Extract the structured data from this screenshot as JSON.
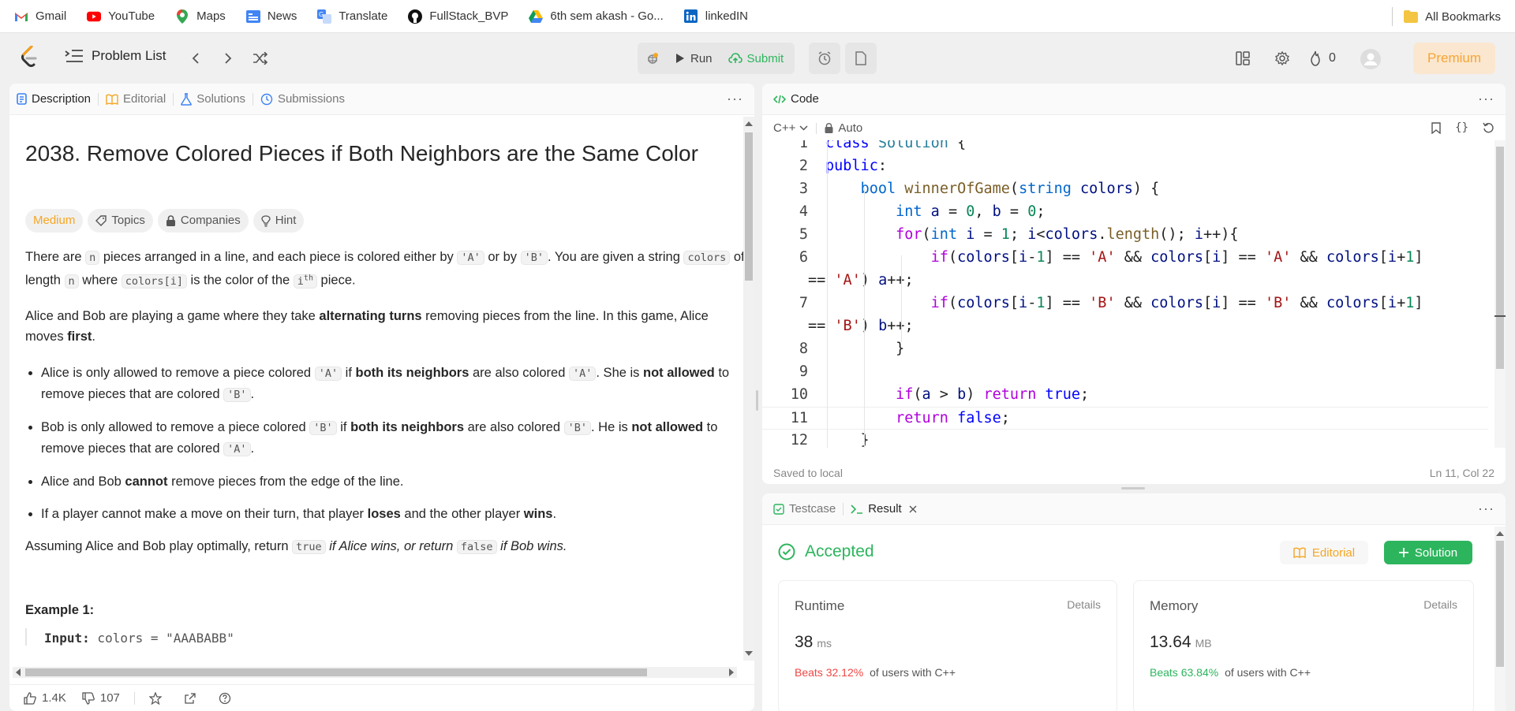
{
  "bookmarks": [
    {
      "label": "Gmail",
      "icon": "gmail-icon"
    },
    {
      "label": "YouTube",
      "icon": "youtube-icon"
    },
    {
      "label": "Maps",
      "icon": "maps-icon"
    },
    {
      "label": "News",
      "icon": "news-icon"
    },
    {
      "label": "Translate",
      "icon": "translate-icon"
    },
    {
      "label": "FullStack_BVP",
      "icon": "github-icon"
    },
    {
      "label": "6th sem akash - Go...",
      "icon": "drive-icon"
    },
    {
      "label": "linkedIN",
      "icon": "linkedin-icon"
    }
  ],
  "all_bookmarks": "All Bookmarks",
  "nav": {
    "problem_list": "Problem List",
    "run": "Run",
    "submit": "Submit",
    "streak": "0",
    "premium": "Premium"
  },
  "desc_tabs": [
    "Description",
    "Editorial",
    "Solutions",
    "Submissions"
  ],
  "problem": {
    "title": "2038. Remove Colored Pieces if Both Neighbors are the Same Color",
    "difficulty": "Medium",
    "topics": "Topics",
    "companies": "Companies",
    "hint": "Hint",
    "p1": {
      "a": "There are ",
      "n": "n",
      "b": " pieces arranged in a line, and each piece is colored either by ",
      "A": "'A'",
      "c": " or by ",
      "B": "'B'",
      "d": ". You are given a string ",
      "colors": "colors",
      "e": " of length ",
      "n2": "n",
      "f": " where ",
      "ci": "colors[i]",
      "g": " is the color of the ",
      "i": "i",
      "th": "th",
      "h": " piece."
    },
    "p2": {
      "a": "Alice and Bob are playing a game where they take ",
      "b": "alternating turns",
      "c": " removing pieces from the line. In this game, Alice moves ",
      "d": "first",
      "e": "."
    },
    "r1": {
      "a": "Alice is only allowed to remove a piece colored ",
      "A": "'A'",
      "b": " if ",
      "c": "both its neighbors",
      "d": " are also colored ",
      "A2": "'A'",
      "e": ". She is ",
      "f": "not allowed",
      "g": " to remove pieces that are colored ",
      "B": "'B'",
      "h": "."
    },
    "r2": {
      "a": "Bob is only allowed to remove a piece colored ",
      "B": "'B'",
      "b": " if ",
      "c": "both its neighbors",
      "d": " are also colored ",
      "B2": "'B'",
      "e": ". He is ",
      "f": "not allowed",
      "g": " to remove pieces that are colored ",
      "A": "'A'",
      "h": "."
    },
    "r3": {
      "a": "Alice and Bob ",
      "b": "cannot",
      "c": " remove pieces from the edge of the line."
    },
    "r4": {
      "a": "If a player cannot make a move on their turn, that player ",
      "b": "loses",
      "c": " and the other player ",
      "d": "wins",
      "e": "."
    },
    "p3": {
      "a": "Assuming Alice and Bob play optimally, return ",
      "t": "true",
      "b": " if Alice wins, or return ",
      "f": "false",
      "c": " if Bob wins."
    },
    "example": "Example 1:",
    "input_label": "Input:",
    "input_value": " colors = \"AAABABB\"",
    "likes": "1.4K",
    "dislikes": "107"
  },
  "code": {
    "tab": "Code",
    "lang": "C++",
    "mode": "Auto",
    "saved": "Saved to local",
    "cursor": "Ln 11, Col 22",
    "line_numbers": [
      "1",
      "2",
      "3",
      "4",
      "5",
      "6",
      "7",
      "8",
      "9",
      "10",
      "11",
      "12"
    ]
  },
  "result": {
    "testcase": "Testcase",
    "result": "Result",
    "status": "Accepted",
    "editorial": "Editorial",
    "solution": "Solution",
    "runtime": {
      "label": "Runtime",
      "details": "Details",
      "value": "38",
      "unit": "ms",
      "beats": "Beats 32.12%",
      "suffix": "of users with C++"
    },
    "memory": {
      "label": "Memory",
      "details": "Details",
      "value": "13.64",
      "unit": "MB",
      "beats": "Beats 63.84%",
      "suffix": "of users with C++"
    }
  },
  "colors": {
    "accent_green": "#2db55d",
    "orange": "#f5a623",
    "red": "#ef4743"
  }
}
